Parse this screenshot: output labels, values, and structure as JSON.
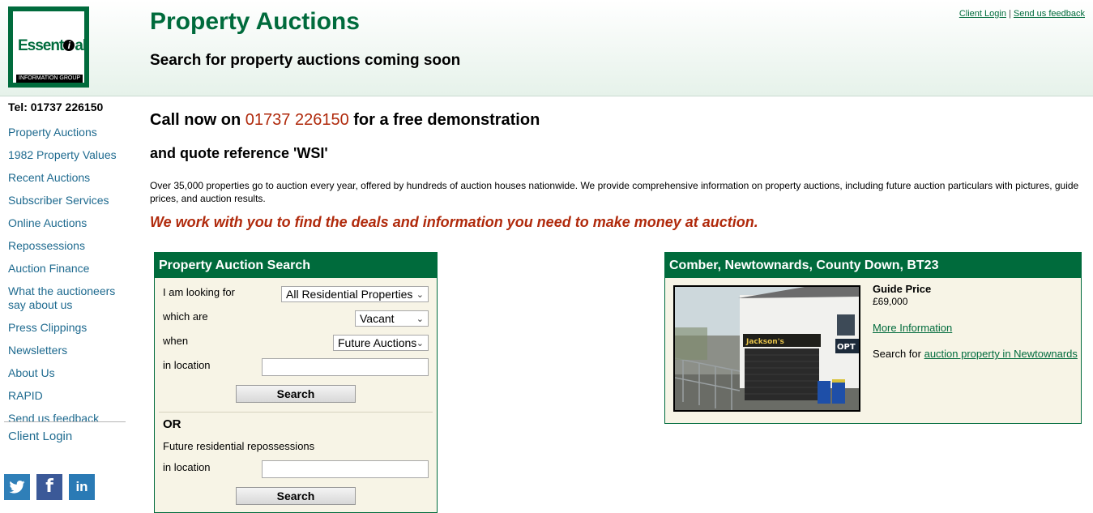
{
  "header": {
    "logo_text_pre": "Essent",
    "logo_text_i": "i",
    "logo_text_post": "al",
    "logo_bar": "INFORMATION GROUP",
    "title": "Property Auctions",
    "subtitle": "Search for property auctions coming soon",
    "client_login": "Client Login",
    "separator": "|",
    "feedback": "Send us feedback"
  },
  "sidebar": {
    "tel": "Tel: 01737 226150",
    "items": [
      {
        "label": "Property Auctions"
      },
      {
        "label": "1982 Property Values"
      },
      {
        "label": "Recent Auctions"
      },
      {
        "label": "Subscriber Services"
      },
      {
        "label": "Online Auctions"
      },
      {
        "label": "Repossessions"
      },
      {
        "label": "Auction Finance"
      },
      {
        "label": "What the auctioneers say about us"
      },
      {
        "label": "Press Clippings"
      },
      {
        "label": "Newsletters"
      },
      {
        "label": "About Us"
      },
      {
        "label": "RAPID"
      },
      {
        "label": "Send us feedback"
      }
    ],
    "client_login": "Client Login",
    "social": {
      "twitter": "twitter-icon",
      "facebook": "facebook-icon",
      "linkedin": "linkedin-icon",
      "fb_glyph": "f",
      "in_glyph": "in"
    }
  },
  "main": {
    "call_pre": "Call now on ",
    "call_phone": "01737 226150",
    "call_post": " for a free demonstration",
    "quote": "and quote reference 'WSI'",
    "intro": "Over 35,000 properties go to auction every year, offered by hundreds of auction houses nationwide. We provide comprehensive information on property auctions, including future auction particulars with pictures, guide prices, and auction results.",
    "tagline": "We work with you to find the deals and information you need to make money at auction."
  },
  "search": {
    "heading": "Property Auction Search",
    "looking_label": "I am looking for",
    "looking_value": "All Residential Properties",
    "which_label": "which are",
    "which_value": "Vacant",
    "when_label": "when",
    "when_value": "Future Auctions",
    "location_label": "in location",
    "location_value": "",
    "button": "Search",
    "or": "OR",
    "repo_label": "Future residential repossessions",
    "repo_location_label": "in location",
    "repo_location_value": "",
    "repo_button": "Search"
  },
  "featured": {
    "heading": "Comber, Newtownards, County Down, BT23",
    "guide_label": "Guide Price",
    "guide_value": "£69,000",
    "more_info": "More Information",
    "search_for_pre": "Search for ",
    "search_for_link": "auction property in Newtownards",
    "shop_sign": "Jackson's",
    "shop_sign_right": "OPT"
  },
  "colors": {
    "brand_green": "#006b3c",
    "accent_red": "#b02a0c",
    "nav_blue": "#1e6a8f",
    "panel_bg": "#f7f4e6"
  }
}
